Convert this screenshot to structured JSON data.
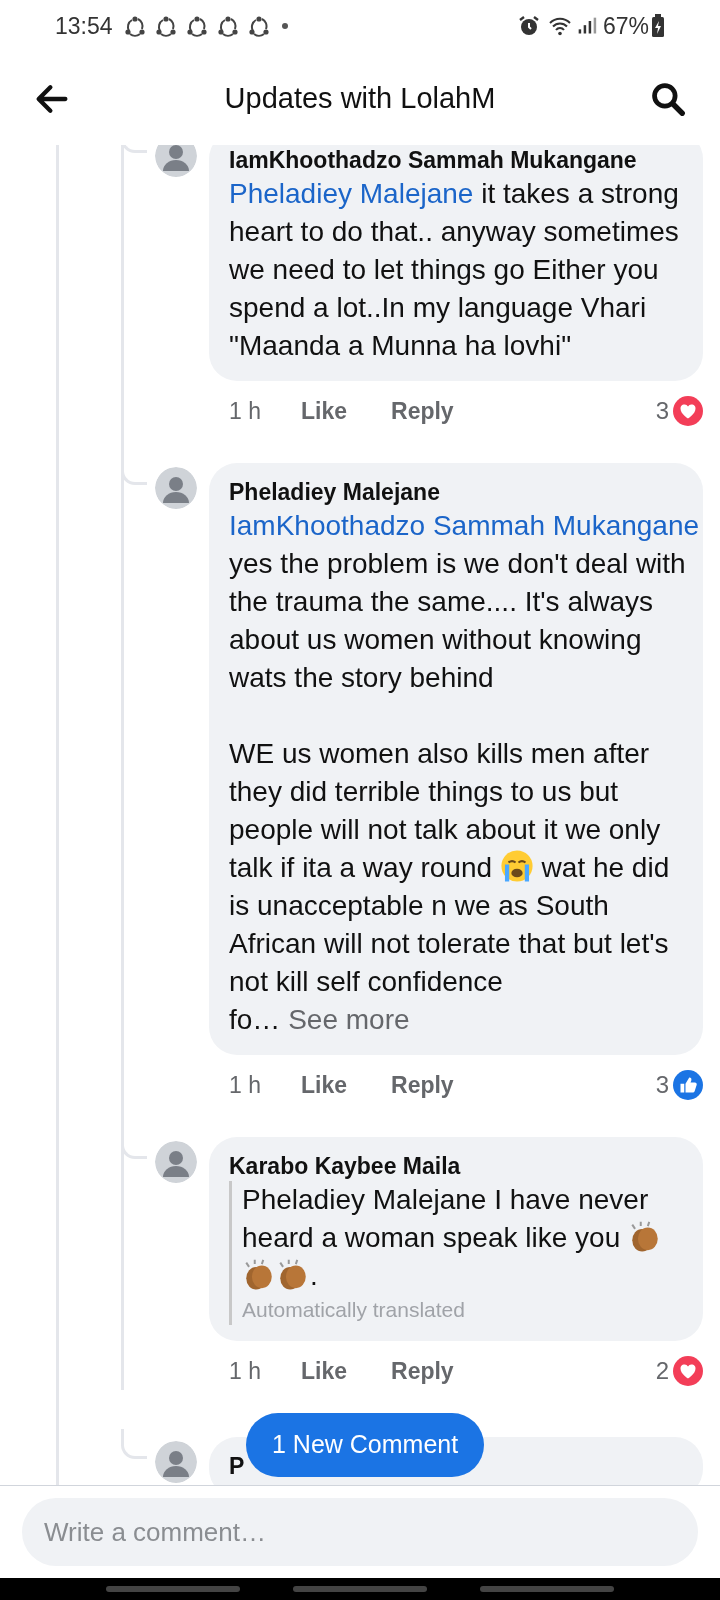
{
  "status_bar": {
    "time": "13:54",
    "battery": "67%"
  },
  "header": {
    "title": "Updates with LolahM"
  },
  "comments": [
    {
      "name": "IamKhoothadzo Sammah Mukangane",
      "paragraphs": [
        [
          {
            "kind": "mention",
            "text": "Pheladiey Malejane"
          },
          {
            "kind": "text",
            "text": " it takes a strong heart to do that.. anyway sometimes we need to let things go Either you spend a lot..In my language Vhari \"Maanda a Munna ha lovhi\""
          }
        ]
      ],
      "time": "1 h",
      "like": "Like",
      "reply": "Reply",
      "reaction": {
        "kind": "heart",
        "count": "3"
      }
    },
    {
      "name": "Pheladiey Malejane",
      "paragraphs": [
        [
          {
            "kind": "mention",
            "text": "IamKhoothadzo Sammah Mukangane"
          },
          {
            "kind": "text",
            "text": " yes the problem is we don't deal with the trauma the same.... It's always about us women without knowing wats the story behind"
          }
        ],
        [
          {
            "kind": "text",
            "text": "WE us women also kills men after they did terrible things to us but people will not talk about it we only talk if ita a way round "
          },
          {
            "kind": "crying_emoji"
          },
          {
            "kind": "text",
            "text": " wat he did is unacceptable n we as South African will not tolerate that but let's not kill self confidence fo…"
          },
          {
            "kind": "see_more",
            "text": " See more"
          }
        ]
      ],
      "time": "1 h",
      "like": "Like",
      "reply": "Reply",
      "reaction": {
        "kind": "like",
        "count": "3"
      }
    },
    {
      "name": "Karabo Kaybee Maila",
      "translated": true,
      "paragraphs": [
        [
          {
            "kind": "text",
            "text": "Pheladiey Malejane I have never heard a woman speak like you "
          },
          {
            "kind": "clapping_emoji"
          },
          {
            "kind": "clapping_emoji"
          },
          {
            "kind": "clapping_emoji"
          },
          {
            "kind": "text",
            "text": "."
          }
        ]
      ],
      "note": "Automatically translated",
      "time": "1 h",
      "like": "Like",
      "reply": "Reply",
      "reaction": {
        "kind": "heart",
        "count": "2"
      }
    },
    {
      "name": "P"
    }
  ],
  "new_comments_button": "1 New Comment",
  "composer": {
    "placeholder": "Write a comment…"
  }
}
